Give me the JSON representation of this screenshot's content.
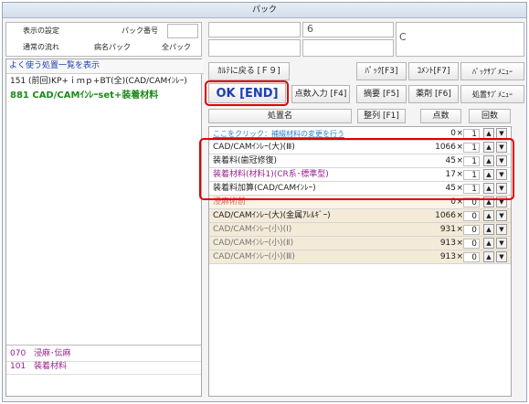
{
  "window": {
    "title": "パック"
  },
  "top_left": {
    "display_setting": "表示の設定",
    "pack_number_label": "パック番号",
    "pack_number_value": "",
    "normal_flow": "通常の流れ",
    "disease_pack": "病名パック",
    "all_pack": "全パック"
  },
  "top_fields": {
    "field1": "",
    "field2": "6",
    "field3": "C",
    "field4": "",
    "field5": ""
  },
  "left_panel": {
    "header": "よく使う処置一覧を表示",
    "items": [
      {
        "text": "151 (前回)KP+ｉｍｐ+BT(全)(CAD/CAMｲﾝﾚｰ)",
        "color": "#222222",
        "bold": false
      },
      {
        "text": "881 CAD/CAMｲﾝﾚｰset+装着材料",
        "color": "#1a8a1a",
        "bold": true
      }
    ],
    "bottom_items": [
      {
        "code": "070",
        "name": "浸麻･伝麻"
      },
      {
        "code": "101",
        "name": "装着材料"
      }
    ]
  },
  "toolbar": {
    "back": "ｶﾙﾃに戻る [Ｆ９]",
    "pack": "ﾊﾟｯｸ[F3]",
    "comment": "ｺﾒﾝﾄ[F7]",
    "pack_submenu": "ﾊﾟｯｸｻﾌﾞﾒﾆｭｰ",
    "ok": "OK [END]",
    "points_input": "点数入力 [F4]",
    "summary": "摘要 [F5]",
    "drug": "薬剤 [F6]",
    "treatment_submenu": "処置ｻﾌﾞﾒﾆｭｰ"
  },
  "grid": {
    "headers": {
      "name": "処置名",
      "sort": "整列 [F1]",
      "points": "点数",
      "count": "回数"
    },
    "note_row": {
      "name": "ここをクリック：補綴材料の変更を行う",
      "points": "0",
      "qty": "1"
    },
    "rows": [
      {
        "name": "CAD/CAMｲﾝﾚｰ(大)(Ⅲ)",
        "points": "1066",
        "qty": "1",
        "color": "#222222",
        "bg": "#ffffff"
      },
      {
        "name": "装着料(歯冠修復)",
        "points": "45",
        "qty": "1",
        "color": "#222222",
        "bg": "#ffffff"
      },
      {
        "name": "装着材料(材料1)(CR系･標準型)",
        "points": "17",
        "qty": "1",
        "color": "#9b1f8e",
        "bg": "#ffffff"
      },
      {
        "name": "装着料加算(CAD/CAMｲﾝﾚｰ)",
        "points": "45",
        "qty": "1",
        "color": "#222222",
        "bg": "#ffffff"
      },
      {
        "name": "浸麻術前",
        "points": "0",
        "qty": "0",
        "color": "#e0605a",
        "bg": "#fbf3e6"
      },
      {
        "name": "CAD/CAMｲﾝﾚｰ(大)(金属ｱﾚﾙｷﾞｰ)",
        "points": "1066",
        "qty": "0",
        "color": "#222222",
        "bg": "#f3ead8"
      },
      {
        "name": "CAD/CAMｲﾝﾚｰ(小)(Ⅰ)",
        "points": "931",
        "qty": "0",
        "color": "#777777",
        "bg": "#f3ead8"
      },
      {
        "name": "CAD/CAMｲﾝﾚｰ(小)(Ⅱ)",
        "points": "913",
        "qty": "0",
        "color": "#777777",
        "bg": "#f3ead8"
      },
      {
        "name": "CAD/CAMｲﾝﾚｰ(小)(Ⅲ)",
        "points": "913",
        "qty": "0",
        "color": "#777777",
        "bg": "#f3ead8"
      }
    ]
  },
  "symbols": {
    "times": "×",
    "up": "▲",
    "down": "▼"
  },
  "colors": {
    "highlight_red": "#e00000",
    "ok_blue": "#1a3fb0",
    "link_blue": "#2a7fd0"
  }
}
